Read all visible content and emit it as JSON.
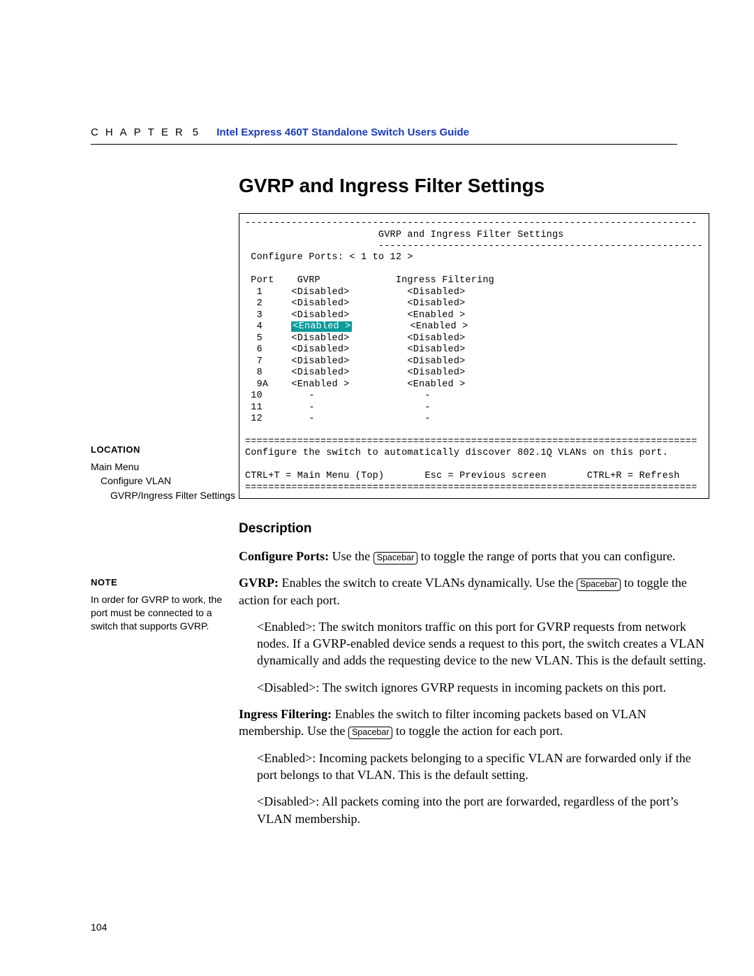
{
  "header": {
    "chapter_word": "CHAPTER",
    "chapter_num": "5",
    "book_title": "Intel Express 460T Standalone Switch Users Guide"
  },
  "section_title": "GVRP and Ingress Filter Settings",
  "terminal": {
    "rule_long": "------------------------------------------------------------------------------",
    "title": "                       GVRP and Ingress Filter Settings",
    "rule_half": "                       --------------------------------------------------------",
    "cfg_line": " Configure Ports: < 1 to 12 >",
    "col_hdr": " Port    GVRP             Ingress Filtering",
    "rows": {
      "r1": "  1     <Disabled>          <Disabled>",
      "r2": "  2     <Disabled>          <Disabled>",
      "r3": "  3     <Disabled>          <Enabled >",
      "r4p": "  4     ",
      "r4h": "<Enabled >",
      "r4s": "          <Enabled >",
      "r5": "  5     <Disabled>          <Disabled>",
      "r6": "  6     <Disabled>          <Disabled>",
      "r7": "  7     <Disabled>          <Disabled>",
      "r8": "  8     <Disabled>          <Disabled>",
      "r9": "  9A    <Enabled >          <Enabled >",
      "r10": " 10        -                   -",
      "r11": " 11        -                   -",
      "r12": " 12        -                   -"
    },
    "rule_dbl": "==============================================================================",
    "helptext": "Configure the switch to automatically discover 802.1Q VLANs on this port.",
    "footer": "CTRL+T = Main Menu (Top)       Esc = Previous screen       CTRL+R = Refresh"
  },
  "sidebar": {
    "location_hdr": "LOCATION",
    "loc1": "Main Menu",
    "loc2": "Configure VLAN",
    "loc3": "GVRP/Ingress Filter Settings",
    "note_hdr": "NOTE",
    "note_body": "In order for GVRP to work, the port must be connected to a switch that supports GVRP."
  },
  "keys": {
    "spacebar": "Spacebar"
  },
  "desc": {
    "heading": "Description",
    "cp_label": "Configure Ports:",
    "cp_a": " Use the ",
    "cp_b": " to toggle the range of ports that you can configure.",
    "gvrp_label": "GVRP:",
    "gvrp_a": " Enables the switch to create VLANs dynamically. Use the ",
    "gvrp_b": " to toggle the action for each port.",
    "gvrp_en": "<Enabled>: The switch monitors traffic on this port for GVRP requests from network nodes. If a GVRP-enabled device sends a request to this port, the switch creates a VLAN dynamically and adds the requesting device to the new VLAN. This is the default setting.",
    "gvrp_dis": "<Disabled>: The switch ignores GVRP requests in incoming packets on this port.",
    "if_label": "Ingress Filtering:",
    "if_a": " Enables the switch to filter incoming packets based on VLAN membership. Use the ",
    "if_b": " to toggle the action for each port.",
    "if_en": "<Enabled>: Incoming packets belonging to a specific VLAN are forwarded only if the port belongs to that VLAN. This is the default setting.",
    "if_dis": "<Disabled>: All packets coming into the port are forwarded, regardless of the port’s VLAN membership."
  },
  "page_number": "104"
}
